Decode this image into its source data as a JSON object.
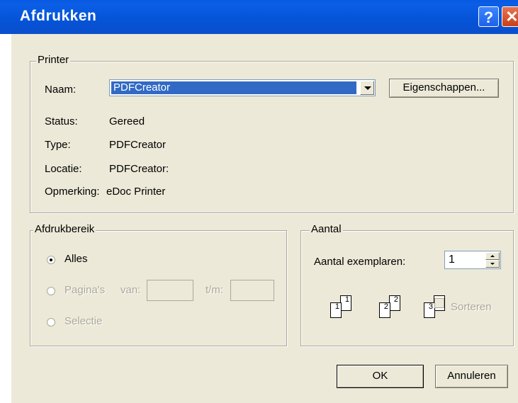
{
  "window": {
    "title": "Afdrukken",
    "help_glyph": "?",
    "close_glyph": "✕"
  },
  "printer": {
    "group_label": "Printer",
    "name_label": "Naam:",
    "name_value": "PDFCreator",
    "properties_button": "Eigenschappen...",
    "status_label": "Status:",
    "status_value": "Gereed",
    "type_label": "Type:",
    "type_value": "PDFCreator",
    "location_label": "Locatie:",
    "location_value": "PDFCreator:",
    "comment_label": "Opmerking:",
    "comment_value": "eDoc Printer"
  },
  "range": {
    "group_label": "Afdrukbereik",
    "all_label": "Alles",
    "pages_label": "Pagina's",
    "from_label": "van:",
    "to_label": "t/m:",
    "selection_label": "Selectie",
    "selected": "all"
  },
  "copies": {
    "group_label": "Aantal",
    "count_label": "Aantal exemplaren:",
    "count_value": "1",
    "collate_label": "Sorteren",
    "collate_checked": false,
    "page_numbers": [
      "1",
      "1",
      "2",
      "2",
      "3"
    ]
  },
  "buttons": {
    "ok": "OK",
    "cancel": "Annuleren"
  },
  "icons": {
    "dropdown": "chevron-down-icon",
    "help": "help-icon",
    "close": "close-icon"
  }
}
